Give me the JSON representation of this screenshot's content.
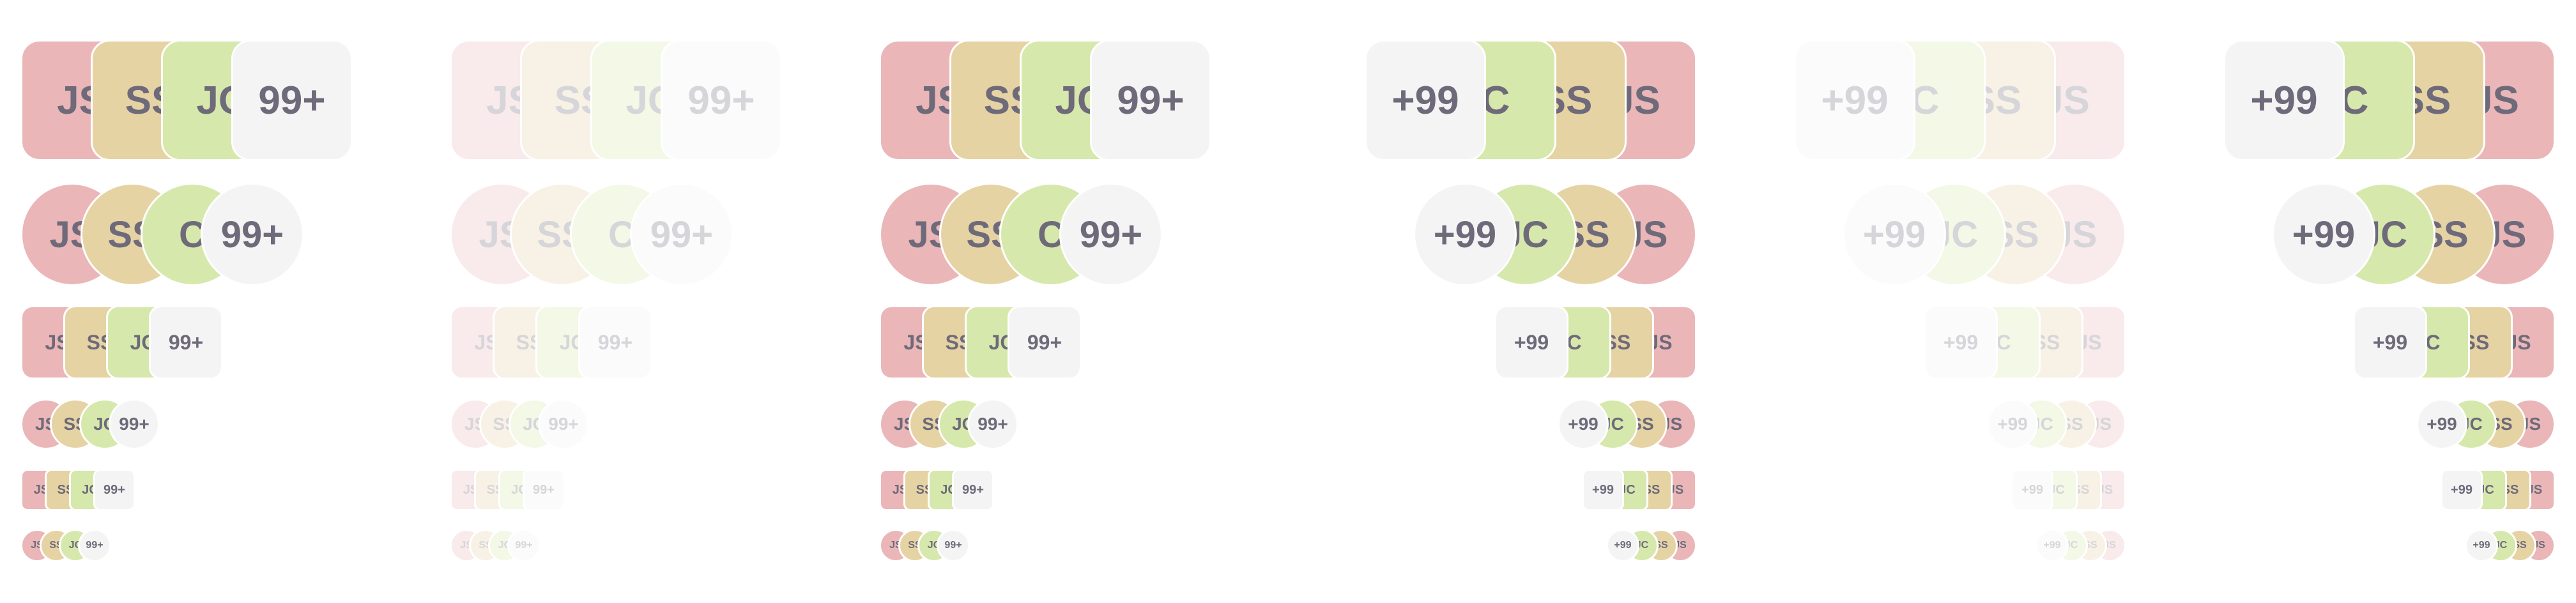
{
  "colors": {
    "js": "#eab6b8",
    "ss": "#e6d3a4",
    "jc": "#d6e8ac",
    "more": "#f4f4f4",
    "text": "#6e6a7a",
    "border": "#ffffff"
  },
  "avatar_groups": [
    {
      "id": "ltr-enabled",
      "direction": "ltr",
      "state": "enabled",
      "rows": [
        {
          "shape": "rounded-square",
          "items": [
            "JS",
            "SS",
            "JC",
            "99+"
          ]
        },
        {
          "shape": "circle",
          "items": [
            "JS",
            "SS",
            "C",
            "99+"
          ]
        },
        {
          "shape": "rounded-square",
          "items": [
            "JS",
            "SS",
            "JC",
            "99+"
          ]
        },
        {
          "shape": "circle",
          "items": [
            "JS",
            "SS",
            "JC",
            "99+"
          ]
        },
        {
          "shape": "rounded-square",
          "items": [
            "JS",
            "SS",
            "JC",
            "99+"
          ]
        },
        {
          "shape": "circle",
          "items": [
            "JS",
            "SS",
            "JC",
            "99+"
          ]
        }
      ]
    },
    {
      "id": "ltr-disabled",
      "direction": "ltr",
      "state": "disabled",
      "rows": [
        {
          "shape": "rounded-square",
          "items": [
            "JS",
            "SS",
            "JC",
            "99+"
          ]
        },
        {
          "shape": "circle",
          "items": [
            "JS",
            "SS",
            "C",
            "99+"
          ]
        },
        {
          "shape": "rounded-square",
          "items": [
            "JS",
            "SS",
            "JC",
            "99+"
          ]
        },
        {
          "shape": "circle",
          "items": [
            "JS",
            "SS",
            "JC",
            "99+"
          ]
        },
        {
          "shape": "rounded-square",
          "items": [
            "JS",
            "SS",
            "JC",
            "99+"
          ]
        },
        {
          "shape": "circle",
          "items": [
            "JS",
            "SS",
            "JC",
            "99+"
          ]
        }
      ]
    },
    {
      "id": "ltr-enabled-2",
      "direction": "ltr",
      "state": "enabled",
      "rows": [
        {
          "shape": "rounded-square",
          "items": [
            "JS",
            "SS",
            "JC",
            "99+"
          ]
        },
        {
          "shape": "circle",
          "items": [
            "JS",
            "SS",
            "C",
            "99+"
          ]
        },
        {
          "shape": "rounded-square",
          "items": [
            "JS",
            "SS",
            "JC",
            "99+"
          ]
        },
        {
          "shape": "circle",
          "items": [
            "JS",
            "SS",
            "JC",
            "99+"
          ]
        },
        {
          "shape": "rounded-square",
          "items": [
            "JS",
            "SS",
            "JC",
            "99+"
          ]
        },
        {
          "shape": "circle",
          "items": [
            "JS",
            "SS",
            "JC",
            "99+"
          ]
        }
      ]
    },
    {
      "id": "rtl-enabled",
      "direction": "rtl",
      "state": "enabled",
      "rows": [
        {
          "shape": "rounded-square",
          "items": [
            "JS",
            "SS",
            "C",
            "+99"
          ]
        },
        {
          "shape": "circle",
          "items": [
            "JS",
            "SS",
            "JC",
            "+99"
          ]
        },
        {
          "shape": "rounded-square",
          "items": [
            "JS",
            "SS",
            "C",
            "+99"
          ]
        },
        {
          "shape": "circle",
          "items": [
            "JS",
            "SS",
            "JC",
            "+99"
          ]
        },
        {
          "shape": "rounded-square",
          "items": [
            "JS",
            "SS",
            "JC",
            "+99"
          ]
        },
        {
          "shape": "circle",
          "items": [
            "JS",
            "SS",
            "JC",
            "+99"
          ]
        }
      ]
    },
    {
      "id": "rtl-disabled",
      "direction": "rtl",
      "state": "disabled",
      "rows": [
        {
          "shape": "rounded-square",
          "items": [
            "JS",
            "SS",
            "C",
            "+99"
          ]
        },
        {
          "shape": "circle",
          "items": [
            "JS",
            "SS",
            "JC",
            "+99"
          ]
        },
        {
          "shape": "rounded-square",
          "items": [
            "JS",
            "SS",
            "C",
            "+99"
          ]
        },
        {
          "shape": "circle",
          "items": [
            "JS",
            "SS",
            "JC",
            "+99"
          ]
        },
        {
          "shape": "rounded-square",
          "items": [
            "JS",
            "SS",
            "JC",
            "+99"
          ]
        },
        {
          "shape": "circle",
          "items": [
            "JS",
            "SS",
            "JC",
            "+99"
          ]
        }
      ]
    },
    {
      "id": "rtl-enabled-2",
      "direction": "rtl",
      "state": "enabled",
      "rows": [
        {
          "shape": "rounded-square",
          "items": [
            "JS",
            "SS",
            "C",
            "+99"
          ]
        },
        {
          "shape": "circle",
          "items": [
            "JS",
            "SS",
            "JC",
            "+99"
          ]
        },
        {
          "shape": "rounded-square",
          "items": [
            "JS",
            "SS",
            "C",
            "+99"
          ]
        },
        {
          "shape": "circle",
          "items": [
            "JS",
            "SS",
            "JC",
            "+99"
          ]
        },
        {
          "shape": "rounded-square",
          "items": [
            "JS",
            "SS",
            "JC",
            "+99"
          ]
        },
        {
          "shape": "circle",
          "items": [
            "JS",
            "SS",
            "JC",
            "+99"
          ]
        }
      ]
    }
  ]
}
